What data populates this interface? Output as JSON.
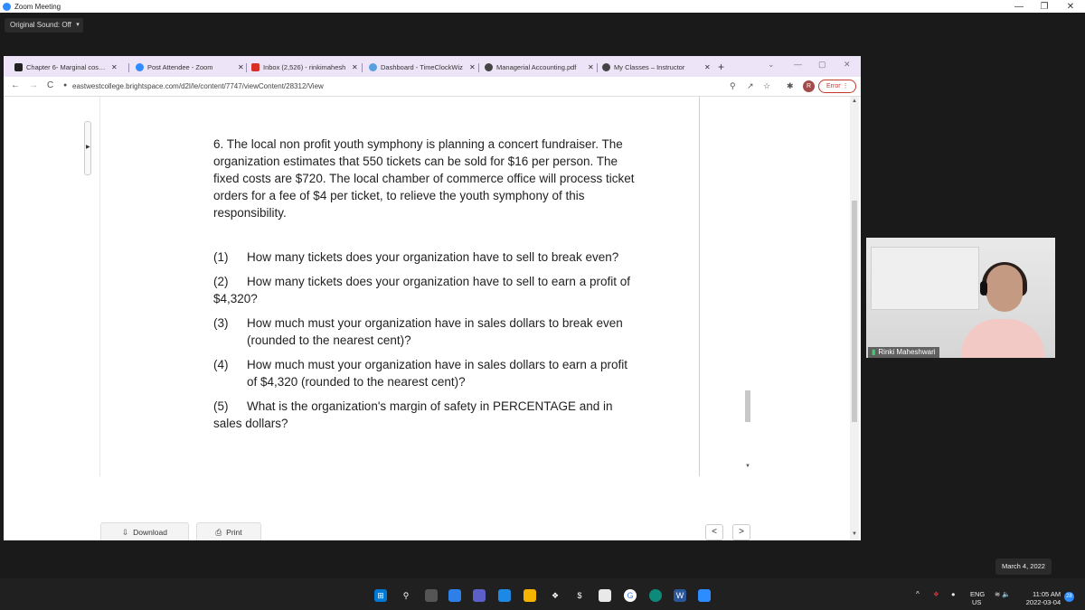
{
  "zoom": {
    "window_title": "Zoom Meeting",
    "original_sound": "Original Sound: Off",
    "caret": "▾",
    "controls": {
      "minimize": "—",
      "restore": "❐",
      "close": "✕"
    }
  },
  "browser": {
    "tabs": [
      {
        "label": "Chapter 6- Marginal costing",
        "close": "✕",
        "fav_color": "#222222",
        "active": false
      },
      {
        "label": "Post Attendee - Zoom",
        "close": "✕",
        "fav_color": "#2d8cff",
        "active": true
      },
      {
        "label": "Inbox (2,526) - rinkimahesh",
        "close": "✕",
        "fav_color": "#d93025",
        "active": false
      },
      {
        "label": "Dashboard - TimeClockWiz",
        "close": "✕",
        "fav_color": "#5aa0e0",
        "active": false
      },
      {
        "label": "Managerial Accounting.pdf",
        "close": "✕",
        "fav_color": "#444444",
        "active": false
      },
      {
        "label": "My Classes – Instructor",
        "close": "✕",
        "fav_color": "#444444",
        "active": false
      }
    ],
    "new_tab": "+",
    "url": "eastwestcollege.brightspace.com/d2l/le/content/7747/viewContent/28312/View",
    "nav": {
      "back": "←",
      "forward": "→",
      "reload": "C"
    },
    "profile_initial": "R",
    "error_label": "Error",
    "error_menu": "⋮"
  },
  "document": {
    "intro": "6. The local non profit youth symphony is planning a concert fundraiser. The organization estimates that 550 tickets can be sold for $16 per person. The fixed costs are $720. The local chamber of commerce office will process ticket orders for a fee of $4 per ticket, to relieve the youth symphony of this responsibility.",
    "questions": [
      {
        "num": "(1)",
        "text": "How many tickets does your organization have to sell to break even?"
      },
      {
        "num": "(2)",
        "text": "How many tickets does your organization have to sell to earn a profit of $4,320?"
      },
      {
        "num": "(3)",
        "text": "How much must your organization have in sales dollars to break even (rounded to the nearest cent)?"
      },
      {
        "num": "(4)",
        "text": "How much must your organization have in sales dollars to earn a profit of $4,320 (rounded to the nearest cent)?"
      },
      {
        "num": "(5)",
        "text": "What is the organization's margin of safety in PERCENTAGE and in sales dollars?"
      }
    ],
    "download_label": "Download",
    "print_label": "Print",
    "prev": "<",
    "next": ">"
  },
  "participant": {
    "name": "Rinki Maheshwari"
  },
  "taskbar": {
    "lang_top": "ENG",
    "lang_bottom": "US",
    "time": "11:05 AM",
    "date": "2022-03-04",
    "date_bubble": "March 4, 2022",
    "notifications": "28"
  }
}
